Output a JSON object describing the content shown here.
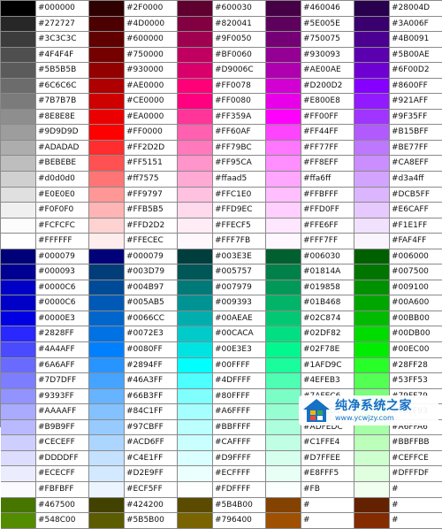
{
  "color_table": {
    "columns": 5,
    "rows": [
      [
        "#000000",
        "#2F0000",
        "#600030",
        "#460046",
        "#28004D"
      ],
      [
        "#272727",
        "#4D0000",
        "#820041",
        "#5E005E",
        "#3A006F"
      ],
      [
        "#3C3C3C",
        "#600000",
        "#9F0050",
        "#750075",
        "#4B0091"
      ],
      [
        "#4F4F4F",
        "#750000",
        "#BF0060",
        "#930093",
        "#5B00AE"
      ],
      [
        "#5B5B5B",
        "#930000",
        "#D9006C",
        "#AE00AE",
        "#6F00D2"
      ],
      [
        "#6C6C6C",
        "#AE0000",
        "#FF0078",
        "#D200D2",
        "#8600FF"
      ],
      [
        "#7B7B7B",
        "#CE0000",
        "#FF0080",
        "#E800E8",
        "#921AFF"
      ],
      [
        "#8E8E8E",
        "#EA0000",
        "#FF359A",
        "#FF00FF",
        "#9F35FF"
      ],
      [
        "#9D9D9D",
        "#FF0000",
        "#FF60AF",
        "#FF44FF",
        "#B15BFF"
      ],
      [
        "#ADADAD",
        "#FF2D2D",
        "#FF79BC",
        "#FF77FF",
        "#BE77FF"
      ],
      [
        "#BEBEBE",
        "#FF5151",
        "#FF95CA",
        "#FF8EFF",
        "#CA8EFF"
      ],
      [
        "#d0d0d0",
        "#ff7575",
        "#ffaad5",
        "#ffa6ff",
        "#d3a4ff"
      ],
      [
        "#E0E0E0",
        "#FF9797",
        "#FFC1E0",
        "#FFBFFF",
        "#DCB5FF"
      ],
      [
        "#F0F0F0",
        "#FFB5B5",
        "#FFD9EC",
        "#FFD0FF",
        "#E6CAFF"
      ],
      [
        "#FCFCFC",
        "#FFD2D2",
        "#FFECF5",
        "#FFE6FF",
        "#F1E1FF"
      ],
      [
        "#FFFFFF",
        "#FFECEC",
        "#FFF7FB",
        "#FFF7FF",
        "#FAF4FF"
      ],
      [
        "#000079",
        "#000079",
        "#003E3E",
        "#006030",
        "#006000"
      ],
      [
        "#000093",
        "#003D79",
        "#005757",
        "#01814A",
        "#007500"
      ],
      [
        "#0000C6",
        "#004B97",
        "#007979",
        "#019858",
        "#009100"
      ],
      [
        "#0000C6",
        "#005AB5",
        "#009393",
        "#01B468",
        "#00A600"
      ],
      [
        "#0000E3",
        "#0066CC",
        "#00AEAE",
        "#02C874",
        "#00BB00"
      ],
      [
        "#2828FF",
        "#0072E3",
        "#00CACA",
        "#02DF82",
        "#00DB00"
      ],
      [
        "#4A4AFF",
        "#0080FF",
        "#00E3E3",
        "#02F78E",
        "#00EC00"
      ],
      [
        "#6A6AFF",
        "#2894FF",
        "#00FFFF",
        "#1AFD9C",
        "#28FF28"
      ],
      [
        "#7D7DFF",
        "#46A3FF",
        "#4DFFFF",
        "#4EFEB3",
        "#53FF53"
      ],
      [
        "#9393FF",
        "#66B3FF",
        "#80FFFF",
        "#7AFEC6",
        "#79FF79"
      ],
      [
        "#AAAAFF",
        "#84C1FF",
        "#A6FFFF",
        "#96FED1",
        "#93FF93"
      ],
      [
        "#B9B9FF",
        "#97CBFF",
        "#BBFFFF",
        "#ADFEDC",
        "#A6FFA6"
      ],
      [
        "#CECEFF",
        "#ACD6FF",
        "#CAFFFF",
        "#C1FFE4",
        "#BBFFBB"
      ],
      [
        "#DDDDFF",
        "#C4E1FF",
        "#D9FFFF",
        "#D7FFEE",
        "#CEFFCE"
      ],
      [
        "#ECECFF",
        "#D2E9FF",
        "#ECFFFF",
        "#E8FFF5",
        "#DFFFDF"
      ],
      [
        "#FBFBFF",
        "#ECF5FF",
        "#FDFFFF",
        "#FB",
        "#"
      ],
      [
        "#467500",
        "#424200",
        "#5B4B00",
        "#",
        "#"
      ],
      [
        "#548C00",
        "#5B5B00",
        "#796400",
        "#",
        "#"
      ]
    ],
    "swatch_colors": [
      [
        "#000000",
        "#2F0000",
        "#600030",
        "#460046",
        "#28004D"
      ],
      [
        "#272727",
        "#4D0000",
        "#820041",
        "#5E005E",
        "#3A006F"
      ],
      [
        "#3C3C3C",
        "#600000",
        "#9F0050",
        "#750075",
        "#4B0091"
      ],
      [
        "#4F4F4F",
        "#750000",
        "#BF0060",
        "#930093",
        "#5B00AE"
      ],
      [
        "#5B5B5B",
        "#930000",
        "#D9006C",
        "#AE00AE",
        "#6F00D2"
      ],
      [
        "#6C6C6C",
        "#AE0000",
        "#FF0078",
        "#D200D2",
        "#8600FF"
      ],
      [
        "#7B7B7B",
        "#CE0000",
        "#FF0080",
        "#E800E8",
        "#921AFF"
      ],
      [
        "#8E8E8E",
        "#EA0000",
        "#FF359A",
        "#FF00FF",
        "#9F35FF"
      ],
      [
        "#9D9D9D",
        "#FF0000",
        "#FF60AF",
        "#FF44FF",
        "#B15BFF"
      ],
      [
        "#ADADAD",
        "#FF2D2D",
        "#FF79BC",
        "#FF77FF",
        "#BE77FF"
      ],
      [
        "#BEBEBE",
        "#FF5151",
        "#FF95CA",
        "#FF8EFF",
        "#CA8EFF"
      ],
      [
        "#D0D0D0",
        "#FF7575",
        "#FFAAD5",
        "#FFA6FF",
        "#D3A4FF"
      ],
      [
        "#E0E0E0",
        "#FF9797",
        "#FFC1E0",
        "#FFBFFF",
        "#DCB5FF"
      ],
      [
        "#F0F0F0",
        "#FFB5B5",
        "#FFD9EC",
        "#FFD0FF",
        "#E6CAFF"
      ],
      [
        "#FCFCFC",
        "#FFD2D2",
        "#FFECF5",
        "#FFE6FF",
        "#F1E1FF"
      ],
      [
        "#FFFFFF",
        "#FFECEC",
        "#FFF7FB",
        "#FFF7FF",
        "#FAF4FF"
      ],
      [
        "#000079",
        "#000079",
        "#003E3E",
        "#006030",
        "#006000"
      ],
      [
        "#000093",
        "#003D79",
        "#005757",
        "#01814A",
        "#007500"
      ],
      [
        "#0000C6",
        "#004B97",
        "#007979",
        "#019858",
        "#009100"
      ],
      [
        "#0000C6",
        "#005AB5",
        "#009393",
        "#01B468",
        "#00A600"
      ],
      [
        "#0000E3",
        "#0066CC",
        "#00AEAE",
        "#02C874",
        "#00BB00"
      ],
      [
        "#2828FF",
        "#0072E3",
        "#00CACA",
        "#02DF82",
        "#00DB00"
      ],
      [
        "#4A4AFF",
        "#0080FF",
        "#00E3E3",
        "#02F78E",
        "#00EC00"
      ],
      [
        "#6A6AFF",
        "#2894FF",
        "#00FFFF",
        "#1AFD9C",
        "#28FF28"
      ],
      [
        "#7D7DFF",
        "#46A3FF",
        "#4DFFFF",
        "#4EFEB3",
        "#53FF53"
      ],
      [
        "#9393FF",
        "#66B3FF",
        "#80FFFF",
        "#7AFEC6",
        "#79FF79"
      ],
      [
        "#AAAAFF",
        "#84C1FF",
        "#A6FFFF",
        "#96FED1",
        "#93FF93"
      ],
      [
        "#B9B9FF",
        "#97CBFF",
        "#BBFFFF",
        "#ADFEDC",
        "#A6FFA6"
      ],
      [
        "#CECEFF",
        "#ACD6FF",
        "#CAFFFF",
        "#C1FFE4",
        "#BBFFBB"
      ],
      [
        "#DDDDFF",
        "#C4E1FF",
        "#D9FFFF",
        "#D7FFEE",
        "#CEFFCE"
      ],
      [
        "#ECECFF",
        "#D2E9FF",
        "#ECFFFF",
        "#E8FFF5",
        "#DFFFDF"
      ],
      [
        "#FBFBFF",
        "#ECF5FF",
        "#FDFFFF",
        "#FBFFFD",
        "#F0FFF0"
      ],
      [
        "#467500",
        "#424200",
        "#5B4B00",
        "#844200",
        "#642100"
      ],
      [
        "#548C00",
        "#5B5B00",
        "#796400",
        "#9F5000",
        "#842B00"
      ]
    ]
  },
  "watermark": {
    "title": "纯净系统之家",
    "url": "www.ycwjzy.com",
    "logo_colors": [
      "#1670c4",
      "#f2b705",
      "#3aa845"
    ]
  }
}
